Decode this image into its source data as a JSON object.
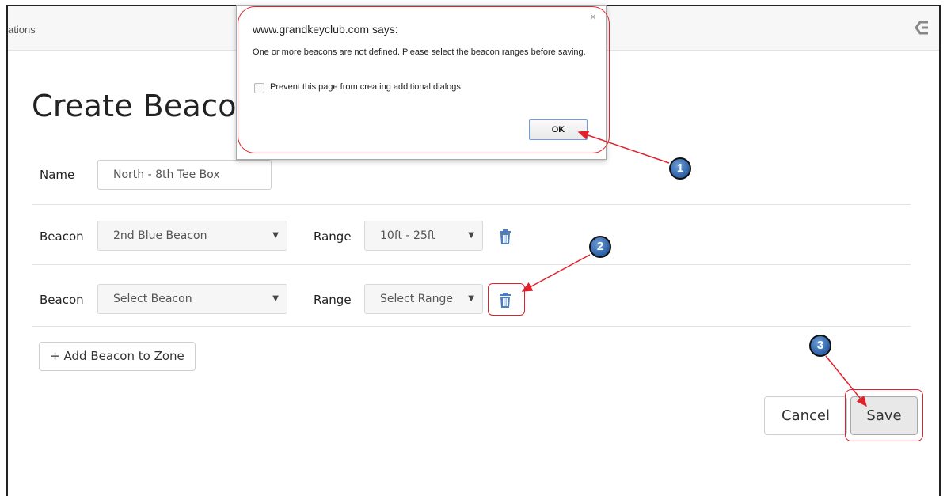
{
  "topbar": {
    "crumb": "ations",
    "logo_icon": "brand-logo-icon"
  },
  "page": {
    "title": "Create Beacon"
  },
  "form": {
    "name_label": "Name",
    "name_value": "North - 8th Tee Box",
    "rows": [
      {
        "beacon_label": "Beacon",
        "beacon_value": "2nd Blue Beacon",
        "range_label": "Range",
        "range_value": "10ft - 25ft"
      },
      {
        "beacon_label": "Beacon",
        "beacon_value": "Select Beacon",
        "range_label": "Range",
        "range_value": "Select Range"
      }
    ],
    "caret": "▼",
    "add_button": "+ Add Beacon to Zone",
    "cancel_button": "Cancel",
    "save_button": "Save"
  },
  "dialog": {
    "origin": "www.grandkeyclub.com says:",
    "message": "One or more beacons are not defined. Please select the beacon ranges before saving.",
    "checkbox_label": "Prevent this page from creating additional dialogs.",
    "ok_button": "OK",
    "close_glyph": "×"
  },
  "annotations": {
    "steps": [
      "1",
      "2",
      "3"
    ],
    "color": "#e0202a",
    "badge_color": "#2a5fa5"
  },
  "colors": {
    "trash_icon": "#4a7fc1"
  }
}
